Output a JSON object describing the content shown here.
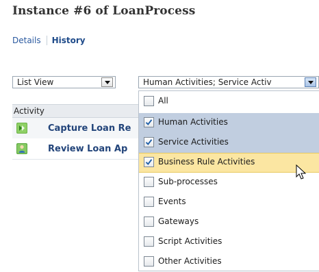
{
  "page": {
    "title": "Instance #6 of LoanProcess"
  },
  "tabs": {
    "details": "Details",
    "history": "History"
  },
  "view_select": {
    "selected": "List View"
  },
  "activity_filter": {
    "selected": "Human Activities; Service Activ"
  },
  "table": {
    "header": "Activity",
    "rows": [
      {
        "name": "Capture Loan Re",
        "icon": "service-task-icon"
      },
      {
        "name": "Review Loan Ap",
        "icon": "human-task-icon"
      }
    ]
  },
  "filter_options": [
    {
      "label": "All",
      "checked": false
    },
    {
      "label": "Human Activities",
      "checked": true
    },
    {
      "label": "Service Activities",
      "checked": true
    },
    {
      "label": "Business Rule Activities",
      "checked": true
    },
    {
      "label": "Sub-processes",
      "checked": false
    },
    {
      "label": "Events",
      "checked": false
    },
    {
      "label": "Gateways",
      "checked": false
    },
    {
      "label": "Script Activities",
      "checked": false
    },
    {
      "label": "Other Activities",
      "checked": false
    }
  ],
  "colors": {
    "selected_row": "#c1cee0",
    "hover_row": "#fbe6a2",
    "link_blue": "#22447a"
  }
}
